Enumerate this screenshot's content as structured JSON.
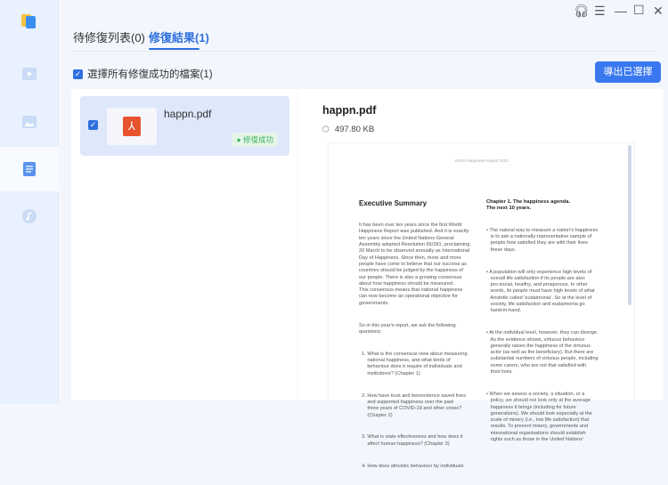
{
  "tabs": [
    {
      "label": "待修復列表(0)"
    },
    {
      "label": "修復結果(1)"
    }
  ],
  "select_all": "選擇所有修復成功的檔案(1)",
  "export_button": "導出已選擇",
  "file": {
    "name": "happn.pdf",
    "status": "修復成功",
    "size": "497.80 KB"
  },
  "sidebar": {
    "items": [
      "app-logo",
      "video",
      "image",
      "document",
      "audio"
    ],
    "active": "document"
  },
  "colors": {
    "accent": "#2f6fe0",
    "success": "#42b35e",
    "pdf": "#e8532f"
  },
  "preview": {
    "header": "World Happiness Report 2023",
    "left_title": "Executive Summary",
    "left_p1": "It has been over ten years since the first World\nHappiness Report was published. And it is exactly\nten years since the United Nations General\nAssembly adopted Resolution 66/281, proclaiming\n20 March to be observed annually as International\nDay of Happiness. Since then, more and more\npeople have come to believe that our success as\ncountries should be judged by the happiness of\nour people. There is also a growing consensus\nabout how happiness should be measured.\nThis consensus means that national happiness\ncan now become an operational objective for\ngovernments.",
    "left_p2": "So in this year's report, we ask the following\nquestions:",
    "left_q": [
      "  1. What is the consensus view about measuring\n      national happiness, and what kinds of\n      behaviour does it require of individuals and\n      institutions? (Chapter 1)",
      "  2. How have trust and benevolence saved lives\n      and supported happiness over the past\n      three years of COVID-19 and other crises?\n      (Chapter 2)",
      "  3. What is state effectiveness and how does it\n      affect human happiness? (Chapter 3)",
      "  4. How does altruistic behaviour by individuals"
    ],
    "right_title": "Chapter 1. The happiness agenda.\nThe next 10 years.",
    "right_b": [
      "• The natural way to measure a nation's happiness\n   is to ask a nationally-representative sample of\n   people how satisfied they are with their lives\n   these days.",
      "• A population will only experience high levels of\n   overall life satisfaction if its people are also\n   pro-social, healthy, and prosperous. In other\n   words, its people must have high levels of what\n   Aristotle called 'eudaimonia'. So at the level of\n   society, life satisfaction and eudaimonia go\n   hand-in-hand.",
      "• At the individual level, however, they can diverge.\n   As the evidence shows, virtuous behaviour\n   generally raises the happiness of the virtuous\n   actor (as well as the beneficiary). But there are\n   substantial numbers of virtuous people, including\n   some carers, who are not that satisfied with\n   their lives.",
      "• When we assess a society, a situation, or a\n   policy, we should not look only at the average\n   happiness it brings (including for future\n   generations). We should look especially at the\n   scale of misery (i.e., low life satisfaction) that\n   results. To prevent misery, governments and\n   international organisations should establish\n   rights such as those in the United Nations'"
    ]
  }
}
